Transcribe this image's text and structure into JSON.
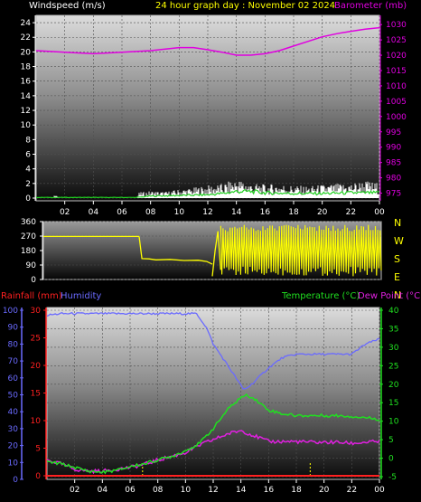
{
  "header": {
    "left_label": "Windspeed (m/s)",
    "center_label": "24 hour graph day : November 02 2024",
    "right_label": "Barometer (mb)"
  },
  "colors": {
    "wind_label": "#ffffff",
    "title": "#ffff00",
    "baro": "#e000e0",
    "dir": "#ffff00",
    "rain": "#ff2020",
    "humidity": "#6a6aff",
    "temp": "#20e020",
    "dew": "#e020e0"
  },
  "compass": [
    "N",
    "W",
    "S",
    "E",
    "N"
  ],
  "bottom_header": {
    "rain_label": "Rainfall (mm)",
    "humidity_label": "Humidity",
    "temp_label": "Temperature (°C)",
    "dew_label": "Dew Point (°C)"
  },
  "chart_data": [
    {
      "type": "line",
      "name": "wind-baro",
      "x_ticks": [
        "02",
        "04",
        "06",
        "08",
        "10",
        "12",
        "14",
        "16",
        "18",
        "20",
        "22",
        "00"
      ],
      "ylim_left": [
        0,
        25
      ],
      "y_ticks_left": [
        0,
        2,
        4,
        6,
        8,
        10,
        12,
        14,
        16,
        18,
        20,
        22,
        24
      ],
      "ylim_right": [
        972.5,
        1033
      ],
      "y_ticks_right": [
        975,
        980,
        985,
        990,
        995,
        1000,
        1005,
        1010,
        1015,
        1020,
        1025,
        1030
      ],
      "barometer": {
        "x": [
          0,
          2,
          4,
          6,
          8,
          10,
          11,
          12,
          13,
          14,
          15,
          16,
          17,
          18,
          19,
          20,
          21,
          22,
          23,
          24
        ],
        "y": [
          1021.5,
          1021,
          1020.5,
          1021,
          1021.5,
          1022.5,
          1022.5,
          1021.8,
          1021,
          1020,
          1020,
          1020.5,
          1021.5,
          1023,
          1024.5,
          1026,
          1027,
          1027.8,
          1028.5,
          1029
        ]
      },
      "wind_peak": {
        "x": [
          0,
          1.2,
          1.3,
          1.6,
          7,
          7.2,
          8,
          9,
          10,
          11,
          12,
          13,
          14,
          14.5,
          15,
          16,
          17,
          18,
          19,
          20,
          21,
          22,
          23,
          24
        ],
        "y": [
          0,
          0,
          0.8,
          0,
          0,
          0.7,
          0.9,
          0.8,
          1.1,
          1.3,
          1.6,
          1.8,
          2.4,
          2.2,
          1.9,
          1.7,
          1.8,
          1.6,
          1.5,
          1.7,
          1.8,
          1.9,
          2.2,
          1.9
        ]
      },
      "wind_avg": {
        "x": [
          0,
          7,
          8,
          10,
          12,
          13,
          14,
          15,
          16,
          18,
          20,
          22,
          24
        ],
        "y": [
          0.1,
          0.1,
          0.3,
          0.4,
          0.5,
          0.7,
          1.0,
          1.0,
          0.8,
          0.7,
          0.7,
          0.8,
          0.8
        ]
      }
    },
    {
      "type": "scatter",
      "name": "wind-direction",
      "x_ticks": [
        "02",
        "04",
        "06",
        "08",
        "10",
        "12",
        "14",
        "16",
        "18",
        "20",
        "22",
        "00"
      ],
      "ylim": [
        0,
        360
      ],
      "y_ticks": [
        0,
        90,
        180,
        270,
        360
      ],
      "segments": [
        {
          "x": [
            0,
            6.8
          ],
          "y": [
            268,
            268
          ]
        },
        {
          "x": [
            6.8,
            7.0,
            7.5,
            8,
            9,
            10,
            11,
            11.6,
            12.0
          ],
          "y": [
            268,
            130,
            128,
            122,
            125,
            118,
            120,
            112,
            95
          ]
        },
        {
          "x": [
            12.0,
            12.2,
            12.4,
            12.6
          ],
          "y": [
            20,
            180,
            300,
            60
          ]
        }
      ],
      "oscillation": {
        "x_start": 12.6,
        "x_end": 24,
        "low": 20,
        "high": 340
      }
    },
    {
      "type": "line",
      "name": "rain-humidity-temp",
      "x_ticks": [
        "02",
        "04",
        "06",
        "08",
        "10",
        "12",
        "14",
        "16",
        "18",
        "20",
        "22",
        "00"
      ],
      "ylim_rain": [
        0,
        30
      ],
      "y_ticks_rain": [
        0,
        5,
        10,
        15,
        20,
        25,
        30
      ],
      "ylim_humidity": [
        0,
        100
      ],
      "y_ticks_humidity": [
        0,
        10,
        20,
        30,
        40,
        50,
        60,
        70,
        80,
        90,
        100
      ],
      "ylim_temp": [
        -5,
        40
      ],
      "y_ticks_temp": [
        -5,
        0,
        5,
        10,
        15,
        20,
        25,
        30,
        35,
        40
      ],
      "humidity": {
        "x": [
          0,
          1,
          4,
          10.8,
          11.5,
          12,
          13,
          13.8,
          14.2,
          14.6,
          15,
          16,
          17,
          18,
          20,
          22,
          23,
          24
        ],
        "y": [
          97,
          98,
          98,
          98,
          90,
          80,
          68,
          58,
          53,
          55,
          58,
          66,
          72,
          74,
          74,
          74,
          80,
          83
        ]
      },
      "temperature": {
        "x": [
          0,
          1,
          2,
          3,
          4,
          5,
          6,
          7,
          8,
          9,
          10,
          11,
          12,
          13,
          14,
          14.5,
          15,
          16,
          17,
          18,
          19,
          20,
          21,
          22,
          23,
          24
        ],
        "y": [
          -1,
          -1.5,
          -2.5,
          -3.5,
          -3.8,
          -3.3,
          -2.3,
          -1.5,
          -0.5,
          0.5,
          2,
          4,
          8,
          13,
          16.5,
          17,
          16,
          13,
          12,
          11.5,
          11.5,
          11.5,
          11.5,
          11.3,
          11,
          10.5
        ]
      },
      "dew_point": {
        "x": [
          0,
          1,
          2,
          3,
          4,
          5,
          6,
          7,
          8,
          9,
          10,
          11,
          12,
          13,
          14,
          15,
          16,
          17,
          18,
          19,
          20,
          21,
          22,
          23,
          24
        ],
        "y": [
          -0.5,
          -1.5,
          -3,
          -3.5,
          -3.5,
          -3,
          -2.5,
          -1.7,
          -0.5,
          0.5,
          1.5,
          3.5,
          5,
          6.5,
          7.5,
          6,
          4.5,
          4.5,
          4.5,
          4.3,
          4.3,
          4.3,
          4,
          4.3,
          4.5
        ]
      },
      "rainfall": {
        "x": [
          0,
          24
        ],
        "y": [
          0,
          0
        ]
      },
      "marker_x": [
        6.9,
        19
      ]
    }
  ]
}
